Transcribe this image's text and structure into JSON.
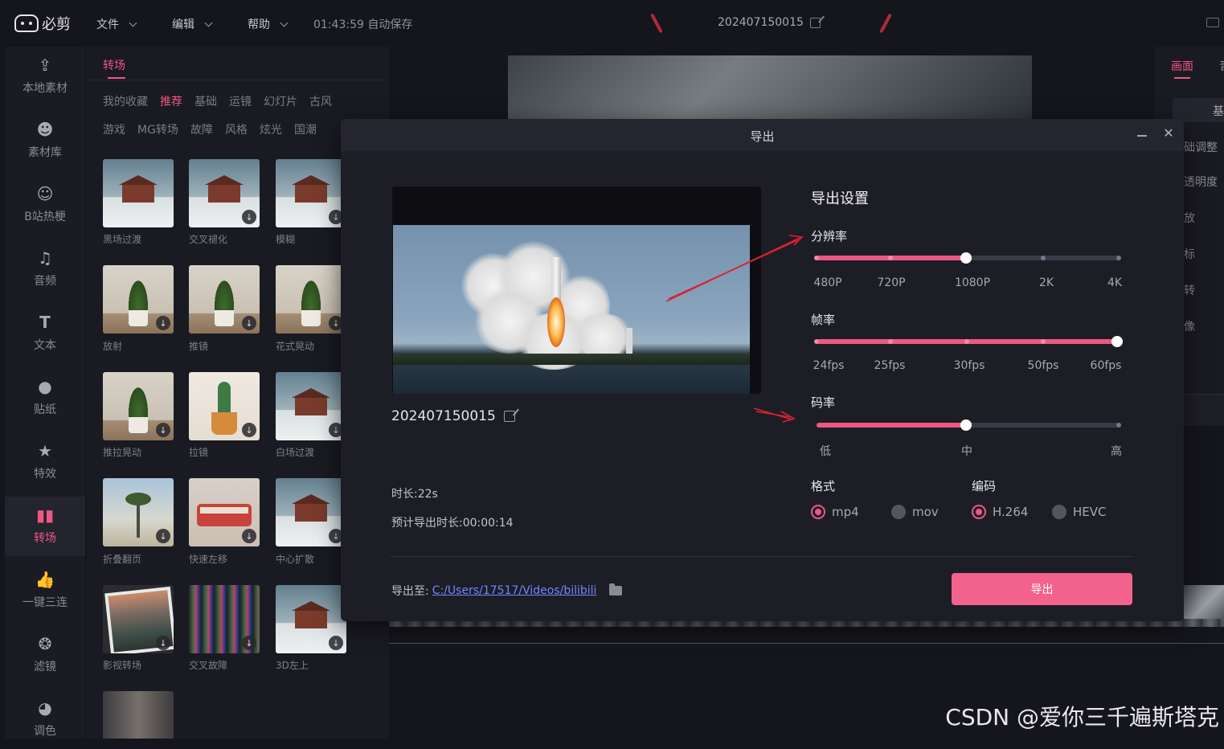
{
  "app": {
    "logo_text": "必剪",
    "menus": [
      "文件",
      "编辑",
      "帮助"
    ],
    "autosave": "01:43:59 自动保存",
    "project_title": "202407150015"
  },
  "left_nav": [
    {
      "label": "本地素材",
      "icon": "upload-icon"
    },
    {
      "label": "素材库",
      "icon": "library-icon"
    },
    {
      "label": "B站热梗",
      "icon": "bilibili-icon"
    },
    {
      "label": "音频",
      "icon": "music-icon"
    },
    {
      "label": "文本",
      "icon": "text-icon"
    },
    {
      "label": "贴纸",
      "icon": "sticker-icon"
    },
    {
      "label": "特效",
      "icon": "effects-icon"
    },
    {
      "label": "转场",
      "icon": "transition-icon",
      "active": true
    },
    {
      "label": "一键三连",
      "icon": "like-icon"
    },
    {
      "label": "滤镜",
      "icon": "filter-icon"
    },
    {
      "label": "调色",
      "icon": "palette-icon"
    }
  ],
  "asset_panel": {
    "tab": "转场",
    "categories_row1": [
      "我的收藏",
      "推荐",
      "基础",
      "运镜",
      "幻灯片",
      "古风"
    ],
    "categories_row2": [
      "游戏",
      "MG转场",
      "故障",
      "风格",
      "炫光",
      "国潮"
    ],
    "active_category": "推荐",
    "items": [
      {
        "label": "黑场过渡",
        "thumb": "house"
      },
      {
        "label": "交叉褪化",
        "thumb": "house"
      },
      {
        "label": "模糊",
        "thumb": "house"
      },
      {
        "label": "放射",
        "thumb": "plant"
      },
      {
        "label": "推镜",
        "thumb": "plant"
      },
      {
        "label": "花式晃动",
        "thumb": "plant"
      },
      {
        "label": "推拉晃动",
        "thumb": "plant"
      },
      {
        "label": "拉镜",
        "thumb": "cactus"
      },
      {
        "label": "白场过渡",
        "thumb": "house"
      },
      {
        "label": "折叠翻页",
        "thumb": "palm"
      },
      {
        "label": "快速左移",
        "thumb": "bus"
      },
      {
        "label": "中心扩散",
        "thumb": "house"
      },
      {
        "label": "影视转场",
        "thumb": "mountain"
      },
      {
        "label": "交叉故障",
        "thumb": "glitch"
      },
      {
        "label": "3D左上",
        "thumb": "house"
      },
      {
        "label": "",
        "thumb": "city"
      }
    ]
  },
  "right_panel": {
    "tab_active": "画面",
    "tab_next": "音",
    "button_partial": "基",
    "labels": [
      "础调整",
      "透明度",
      "放",
      "标",
      "转",
      "像"
    ]
  },
  "export_dialog": {
    "title": "导出",
    "filename": "202407150015",
    "duration": "时长:22s",
    "estimated_time": "预计导出时长:00:00:14",
    "settings_title": "导出设置",
    "resolution": {
      "label": "分辨率",
      "options": [
        "480P",
        "720P",
        "1080P",
        "2K",
        "4K"
      ],
      "selected": "1080P"
    },
    "framerate": {
      "label": "帧率",
      "options": [
        "24fps",
        "25fps",
        "30fps",
        "50fps",
        "60fps"
      ],
      "selected": "60fps"
    },
    "bitrate": {
      "label": "码率",
      "options": [
        "低",
        "中",
        "高"
      ],
      "selected": "中"
    },
    "format": {
      "label": "格式",
      "options": [
        "mp4",
        "mov"
      ],
      "selected": "mp4"
    },
    "codec": {
      "label": "编码",
      "options": [
        "H.264",
        "HEVC"
      ],
      "selected": "H.264"
    },
    "export_path_label": "导出至:",
    "export_path": "C:/Users/17517/Videos/bilibili",
    "export_button": "导出"
  },
  "watermark": "CSDN @爱你三千遍斯塔克",
  "colors": {
    "accent": "#ee5783",
    "button": "#f3618d",
    "annotation_arrow": "#d8232f"
  }
}
